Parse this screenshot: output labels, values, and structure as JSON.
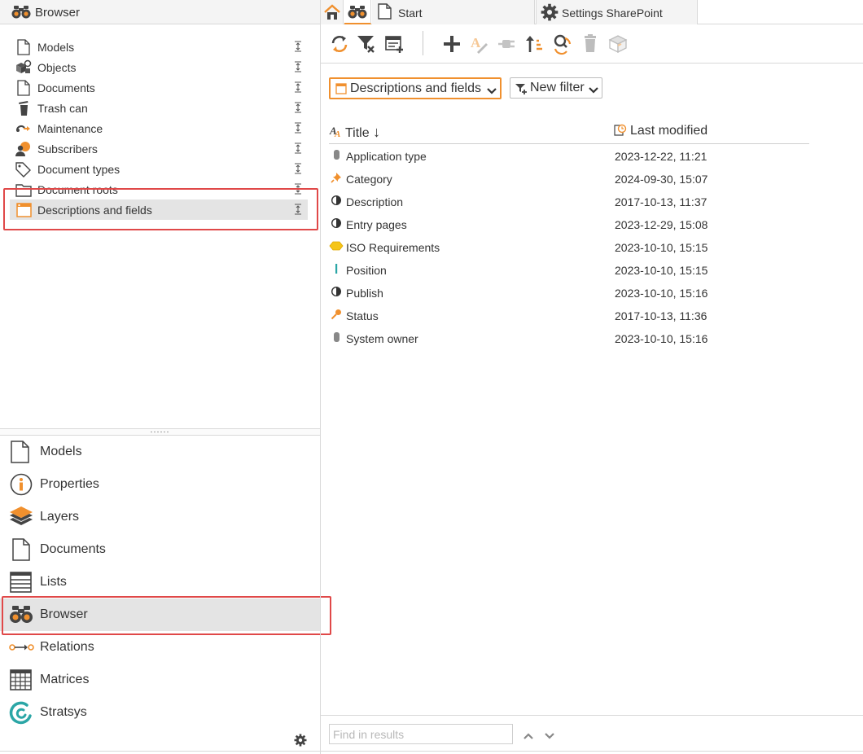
{
  "left_panel": {
    "title": "Browser",
    "tree_items": [
      {
        "label": "Models",
        "icon": "page-icon"
      },
      {
        "label": "Objects",
        "icon": "objects-icon"
      },
      {
        "label": "Documents",
        "icon": "page-icon"
      },
      {
        "label": "Trash can",
        "icon": "trash-icon"
      },
      {
        "label": "Maintenance",
        "icon": "maintenance-icon"
      },
      {
        "label": "Subscribers",
        "icon": "subscribers-icon"
      },
      {
        "label": "Document types",
        "icon": "tag-icon"
      },
      {
        "label": "Document roots",
        "icon": "folder-icon"
      },
      {
        "label": "Descriptions and fields",
        "icon": "window-icon",
        "selected": true
      }
    ]
  },
  "nav": {
    "items": [
      {
        "label": "Models",
        "icon": "page-icon"
      },
      {
        "label": "Properties",
        "icon": "info-icon"
      },
      {
        "label": "Layers",
        "icon": "layers-icon"
      },
      {
        "label": "Documents",
        "icon": "page-icon"
      },
      {
        "label": "Lists",
        "icon": "list-icon"
      },
      {
        "label": "Browser",
        "icon": "binoculars-icon",
        "selected": true
      },
      {
        "label": "Relations",
        "icon": "relations-icon"
      },
      {
        "label": "Matrices",
        "icon": "grid-icon"
      },
      {
        "label": "Stratsys",
        "icon": "stratsys-icon"
      }
    ]
  },
  "tabs": {
    "start": "Start",
    "settings": "Settings SharePoint"
  },
  "filter": {
    "view_label": "Descriptions and fields",
    "new_filter_label": "New filter"
  },
  "table": {
    "col_title": "Title",
    "col_modified": "Last modified",
    "sort_arrow": "↓",
    "rows": [
      {
        "title": "Application type",
        "modified": "2023-12-22, 11:21",
        "icon": "cylinder-icon"
      },
      {
        "title": "Category",
        "modified": "2024-09-30, 15:07",
        "icon": "pin-icon"
      },
      {
        "title": "Description",
        "modified": "2017-10-13, 11:37",
        "icon": "half-circle-icon"
      },
      {
        "title": "Entry pages",
        "modified": "2023-12-29, 15:08",
        "icon": "half-circle-icon"
      },
      {
        "title": "ISO Requirements",
        "modified": "2023-10-10, 15:15",
        "icon": "hexagon-icon"
      },
      {
        "title": "Position",
        "modified": "2023-10-10, 15:15",
        "icon": "bar-icon"
      },
      {
        "title": "Publish",
        "modified": "2023-10-10, 15:16",
        "icon": "half-circle-icon"
      },
      {
        "title": "Status",
        "modified": "2017-10-13, 11:36",
        "icon": "key-icon"
      },
      {
        "title": "System owner",
        "modified": "2023-10-10, 15:16",
        "icon": "cylinder-icon"
      }
    ]
  },
  "find": {
    "placeholder": "Find in results"
  },
  "colors": {
    "accent": "#f0902e",
    "highlight": "#e04848",
    "selected_bg": "#e4e4e4",
    "icon_dark": "#444444",
    "teal": "#2ba6a6"
  }
}
